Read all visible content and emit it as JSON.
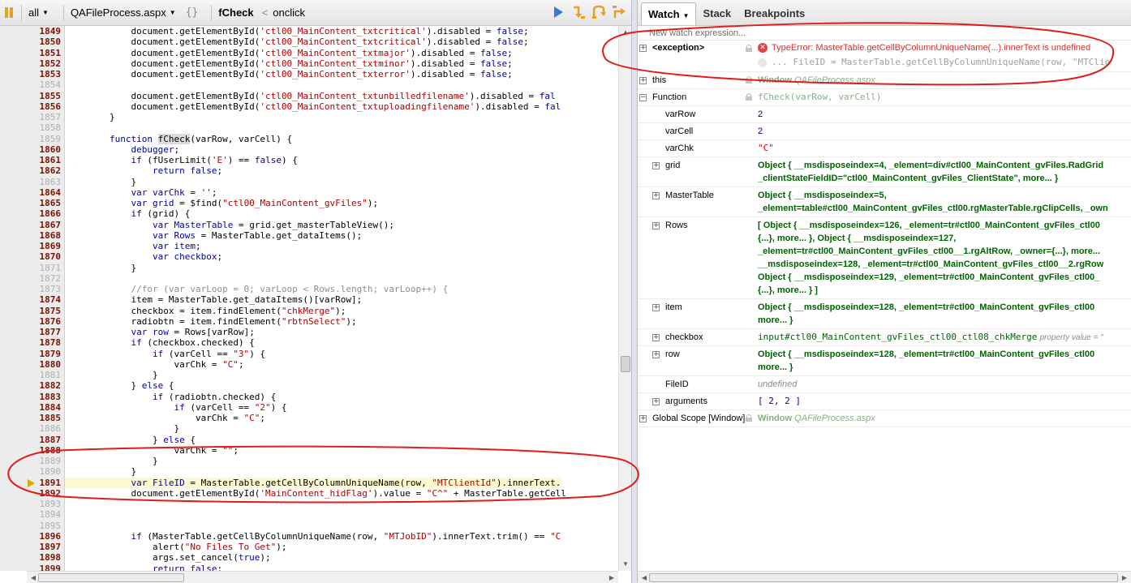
{
  "toolbar": {
    "scope": "all",
    "file": "QAFileProcess.aspx",
    "braces": "{}",
    "function_name": "fCheck",
    "caller_sep": "<",
    "caller": "onclick"
  },
  "code_lines": [
    {
      "num": "1849",
      "dim": false,
      "html": "            document.getElementById(<span class=\"str\">'ctl00_MainContent_txtcritical'</span>).disabled = <span class=\"kw\">false</span>;"
    },
    {
      "num": "1850",
      "dim": false,
      "html": "            document.getElementById(<span class=\"str\">'ctl00_MainContent_txtcritical'</span>).disabled = <span class=\"kw\">false</span>;"
    },
    {
      "num": "1851",
      "dim": false,
      "html": "            document.getElementById(<span class=\"str\">'ctl00_MainContent_txtmajor'</span>).disabled = <span class=\"kw\">false</span>;"
    },
    {
      "num": "1852",
      "dim": false,
      "html": "            document.getElementById(<span class=\"str\">'ctl00_MainContent_txtminor'</span>).disabled = <span class=\"kw\">false</span>;"
    },
    {
      "num": "1853",
      "dim": false,
      "html": "            document.getElementById(<span class=\"str\">'ctl00_MainContent_txterror'</span>).disabled = <span class=\"kw\">false</span>;"
    },
    {
      "num": "1854",
      "dim": true,
      "html": ""
    },
    {
      "num": "1855",
      "dim": false,
      "html": "            document.getElementById(<span class=\"str\">'ctl00_MainContent_txtunbilledfilename'</span>).disabled = <span class=\"kw\">fal</span>"
    },
    {
      "num": "1856",
      "dim": false,
      "html": "            document.getElementById(<span class=\"str\">'ctl00_MainContent_txtuploadingfilename'</span>).disabled = <span class=\"kw\">fal</span>"
    },
    {
      "num": "1857",
      "dim": true,
      "html": "        }"
    },
    {
      "num": "1858",
      "dim": true,
      "html": ""
    },
    {
      "num": "1859",
      "dim": true,
      "html": "        <span class=\"kw\">function</span> <span class=\"fnhl\">fCheck</span>(varRow, varCell) {"
    },
    {
      "num": "1860",
      "dim": false,
      "html": "            <span class=\"kw\">debugger</span>;"
    },
    {
      "num": "1861",
      "dim": false,
      "html": "            <span class=\"kw\">if</span> (fUserLimit(<span class=\"str\">'E'</span>) == <span class=\"kw\">false</span>) {"
    },
    {
      "num": "1862",
      "dim": false,
      "html": "                <span class=\"kw\">return</span> <span class=\"kw\">false</span>;"
    },
    {
      "num": "1863",
      "dim": true,
      "html": "            }"
    },
    {
      "num": "1864",
      "dim": false,
      "html": "            <span class=\"kw\">var</span> <span class=\"kw\">varChk</span> = <span class=\"str\">''</span>;"
    },
    {
      "num": "1865",
      "dim": false,
      "html": "            <span class=\"kw\">var</span> <span class=\"kw\">grid</span> = $find(<span class=\"str\">\"ctl00_MainContent_gvFiles\"</span>);"
    },
    {
      "num": "1866",
      "dim": false,
      "html": "            <span class=\"kw\">if</span> (grid) {"
    },
    {
      "num": "1867",
      "dim": false,
      "html": "                <span class=\"kw\">var</span> <span class=\"kw\">MasterTable</span> = grid.get_masterTableView();"
    },
    {
      "num": "1868",
      "dim": false,
      "html": "                <span class=\"kw\">var</span> <span class=\"kw\">Rows</span> = MasterTable.get_dataItems();"
    },
    {
      "num": "1869",
      "dim": false,
      "html": "                <span class=\"kw\">var</span> <span class=\"kw\">item</span>;"
    },
    {
      "num": "1870",
      "dim": false,
      "html": "                <span class=\"kw\">var</span> <span class=\"kw\">checkbox</span>;"
    },
    {
      "num": "1871",
      "dim": true,
      "html": "            }"
    },
    {
      "num": "1872",
      "dim": true,
      "html": ""
    },
    {
      "num": "1873",
      "dim": true,
      "html": "            <span class=\"cmt\">//for (var varLoop = 0; varLoop &lt; Rows.length; varLoop++) {</span>"
    },
    {
      "num": "1874",
      "dim": false,
      "html": "            item = MasterTable.get_dataItems()[varRow];"
    },
    {
      "num": "1875",
      "dim": false,
      "html": "            checkbox = item.findElement(<span class=\"str\">\"chkMerge\"</span>);"
    },
    {
      "num": "1876",
      "dim": false,
      "html": "            radiobtn = item.findElement(<span class=\"str\">\"rbtnSelect\"</span>);"
    },
    {
      "num": "1877",
      "dim": false,
      "html": "            <span class=\"kw\">var</span> <span class=\"kw\">row</span> = Rows[varRow];"
    },
    {
      "num": "1878",
      "dim": false,
      "html": "            <span class=\"kw\">if</span> (checkbox.checked) {"
    },
    {
      "num": "1879",
      "dim": false,
      "html": "                <span class=\"kw\">if</span> (varCell == <span class=\"str\">\"3\"</span>) {"
    },
    {
      "num": "1880",
      "dim": false,
      "html": "                    varChk = <span class=\"str\">\"C\"</span>;"
    },
    {
      "num": "1881",
      "dim": true,
      "html": "                }"
    },
    {
      "num": "1882",
      "dim": false,
      "html": "            } <span class=\"kw\">else</span> {"
    },
    {
      "num": "1883",
      "dim": false,
      "html": "                <span class=\"kw\">if</span> (radiobtn.checked) {"
    },
    {
      "num": "1884",
      "dim": false,
      "html": "                    <span class=\"kw\">if</span> (varCell == <span class=\"str\">\"2\"</span>) {"
    },
    {
      "num": "1885",
      "dim": false,
      "html": "                        varChk = <span class=\"str\">\"C\"</span>;"
    },
    {
      "num": "1886",
      "dim": true,
      "html": "                    }"
    },
    {
      "num": "1887",
      "dim": false,
      "html": "                } <span class=\"kw\">else</span> {"
    },
    {
      "num": "1888",
      "dim": false,
      "html": "                    varChk = <span class=\"str\">\"\"</span>;"
    },
    {
      "num": "1889",
      "dim": true,
      "html": "                }"
    },
    {
      "num": "1890",
      "dim": true,
      "html": "            }"
    },
    {
      "num": "1891",
      "dim": false,
      "current": true,
      "html": "            <span class=\"kw\">var</span> <span class=\"kw\">FileID</span> = MasterTable.getCellByColumnUniqueName(row, <span class=\"str\">\"MTClientId\"</span>).innerText."
    },
    {
      "num": "1892",
      "dim": false,
      "html": "            document.getElementById(<span class=\"str\">'MainContent_hidFlag'</span>).value = <span class=\"str\">\"C^\"</span> + MasterTable.getCell"
    },
    {
      "num": "1893",
      "dim": true,
      "html": ""
    },
    {
      "num": "1894",
      "dim": true,
      "html": ""
    },
    {
      "num": "1895",
      "dim": true,
      "html": ""
    },
    {
      "num": "1896",
      "dim": false,
      "html": "            <span class=\"kw\">if</span> (MasterTable.getCellByColumnUniqueName(row, <span class=\"str\">\"MTJobID\"</span>).innerText.trim() == <span class=\"str\">\"C</span>"
    },
    {
      "num": "1897",
      "dim": false,
      "html": "                alert(<span class=\"str\">\"No Files To Get\"</span>);"
    },
    {
      "num": "1898",
      "dim": false,
      "html": "                args.set_cancel(<span class=\"kw\">true</span>);"
    },
    {
      "num": "1899",
      "dim": false,
      "html": "                <span class=\"kw\">return</span> <span class=\"kw\">false</span>;"
    },
    {
      "num": "1900",
      "dim": true,
      "html": "            }"
    }
  ],
  "tabs": {
    "watch": "Watch",
    "stack": "Stack",
    "breakpoints": "Breakpoints"
  },
  "watch": {
    "new_expression": "New watch expression...",
    "exception": {
      "name": "<exception>",
      "value": "TypeError: MasterTable.getCellByColumnUniqueName(...).innerText is undefined",
      "source": "... FileID = MasterTable.getCellByColumnUniqueName(row, \"MTClie"
    },
    "this_row": {
      "name": "this",
      "value_bold": "Window",
      "value_italic": "QAFileProcess.aspx"
    },
    "function_row": {
      "name": "Function",
      "value": "fCheck(varRow, varCell)"
    },
    "vars": {
      "varRow": {
        "name": "varRow",
        "value": "2"
      },
      "varCell": {
        "name": "varCell",
        "value": "2"
      },
      "varChk": {
        "name": "varChk",
        "value": "\"C\""
      },
      "grid": {
        "name": "grid",
        "line1": "Object { __msdisposeindex=4, _element=div#ctl00_MainContent_gvFiles.RadGrid",
        "line2": "_clientStateFieldID=\"ctl00_MainContent_gvFiles_ClientState\", more... }"
      },
      "MasterTable": {
        "name": "MasterTable",
        "line1": "Object { __msdisposeindex=5,",
        "line2": "_element=table#ctl00_MainContent_gvFiles_ctl00.rgMasterTable.rgClipCells, _own"
      },
      "Rows": {
        "name": "Rows",
        "line1": "[ Object { __msdisposeindex=126, _element=tr#ctl00_MainContent_gvFiles_ctl00",
        "line2": "{...}, more... }, Object { __msdisposeindex=127,",
        "line3": "_element=tr#ctl00_MainContent_gvFiles_ctl00__1.rgAltRow, _owner={...}, more...",
        "line4": "__msdisposeindex=128, _element=tr#ctl00_MainContent_gvFiles_ctl00__2.rgRow",
        "line5": "Object { __msdisposeindex=129, _element=tr#ctl00_MainContent_gvFiles_ctl00_",
        "line6": "{...}, more... } ]"
      },
      "item": {
        "name": "item",
        "line1": "Object { __msdisposeindex=128, _element=tr#ctl00_MainContent_gvFiles_ctl00",
        "line2": "more... }"
      },
      "checkbox": {
        "name": "checkbox",
        "value": "input#ctl00_MainContent_gvFiles_ctl00_ctl08_chkMerge",
        "extra": "property value = \""
      },
      "row": {
        "name": "row",
        "line1": "Object { __msdisposeindex=128, _element=tr#ctl00_MainContent_gvFiles_ctl00",
        "line2": "more... }"
      },
      "FileID": {
        "name": "FileID",
        "value": "undefined"
      },
      "arguments": {
        "name": "arguments",
        "value": "[ 2, 2 ]"
      }
    },
    "global": {
      "name": "Global Scope [Window]",
      "value_bold": "Window",
      "value_italic": "QAFileProcess.aspx"
    }
  },
  "colors": {
    "annotation": "#e21b1b",
    "current_line": "#fffacd",
    "exec_arrow": "#e0a800"
  }
}
